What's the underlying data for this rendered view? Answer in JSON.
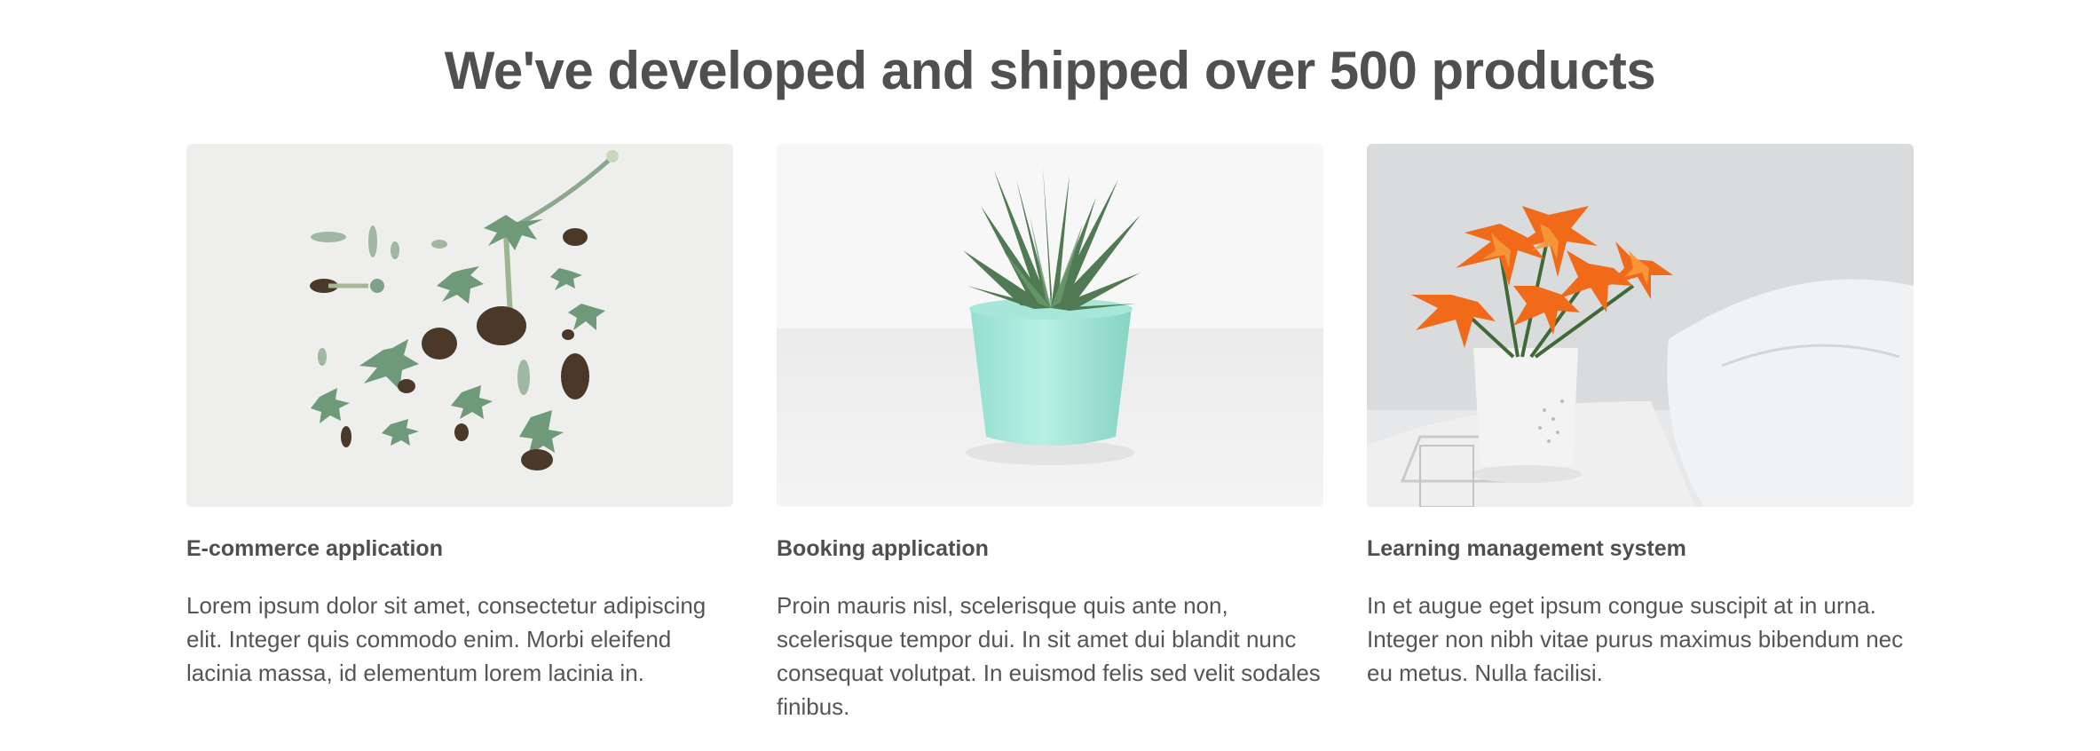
{
  "section": {
    "title": "We've developed and shipped over 500 products"
  },
  "cards": [
    {
      "title": "E-commerce application",
      "description": "Lorem ipsum dolor sit amet, consectetur adipiscing elit. Integer quis commodo enim. Morbi eleifend lacinia massa, id elementum lorem lacinia in.",
      "image": "succulent-cuttings-photo"
    },
    {
      "title": "Booking application",
      "description": "Proin mauris nisl, scelerisque quis ante non, scelerisque tempor dui. In sit amet dui blandit nunc consequat volutpat. In euismod felis sed velit sodales finibus.",
      "image": "potted-plant-photo"
    },
    {
      "title": "Learning management system",
      "description": "In et augue eget ipsum congue suscipit at in urna. Integer non nibh vitae purus maximus bibendum nec eu metus. Nulla facilisi.",
      "image": "orange-lilies-vase-photo"
    }
  ],
  "colors": {
    "heading": "#505050",
    "text": "#555555",
    "background": "#ffffff"
  }
}
